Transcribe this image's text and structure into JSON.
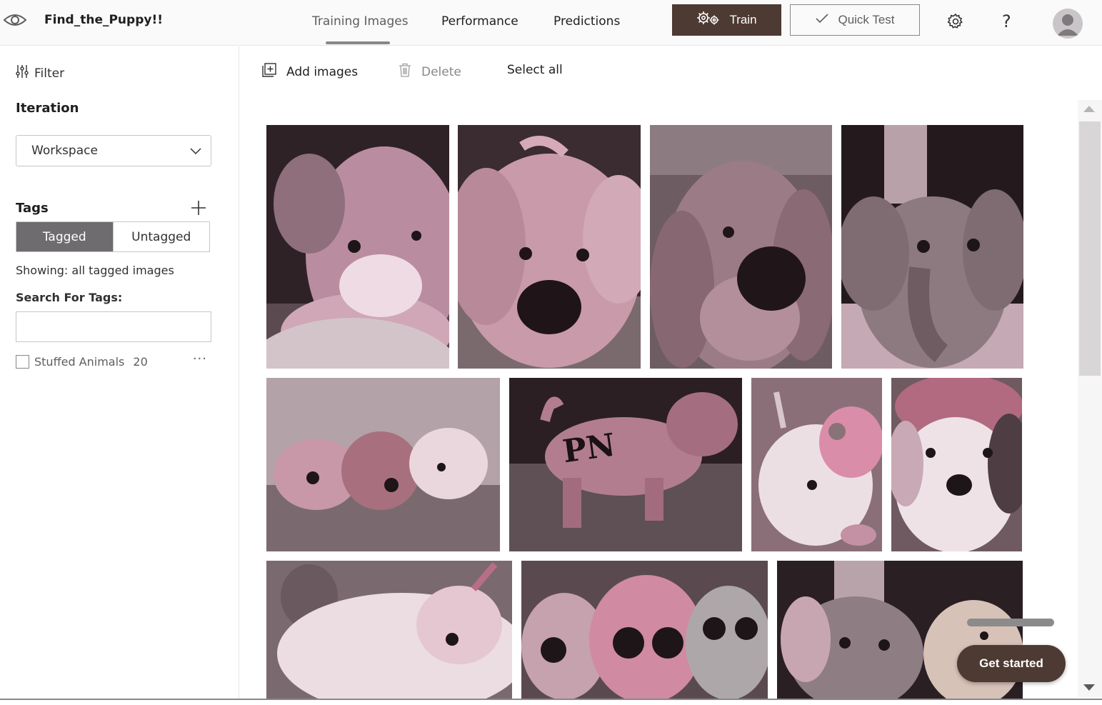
{
  "header": {
    "project_name": "Find_the_Puppy!!",
    "tabs": [
      {
        "label": "Training Images",
        "active": true
      },
      {
        "label": "Performance",
        "active": false
      },
      {
        "label": "Predictions",
        "active": false
      }
    ],
    "train_label": "Train",
    "quick_test_label": "Quick Test",
    "help_label": "?",
    "icons": {
      "logo": "eye-icon",
      "settings": "gear-icon",
      "train": "gears-icon",
      "quick_test": "checkmark-icon",
      "avatar": "user-avatar"
    },
    "accent_color": "#4d3a33"
  },
  "sidebar": {
    "filter_label": "Filter",
    "iteration_heading": "Iteration",
    "iteration_selected": "Workspace",
    "tags_heading": "Tags",
    "toggle": {
      "tagged": "Tagged",
      "untagged": "Untagged",
      "selected": "Tagged"
    },
    "showing_text": "Showing: all tagged images",
    "search_label": "Search For Tags:",
    "search_value": "",
    "tags": [
      {
        "name": "Stuffed Animals",
        "count": "20",
        "checked": false,
        "more": "···"
      }
    ]
  },
  "toolbar": {
    "add_images_label": "Add images",
    "delete_label": "Delete",
    "select_all_label": "Select all"
  },
  "gallery": {
    "image_count_visible": 11,
    "subjects": [
      "pink plush bunny",
      "pink plush puppy",
      "brown plush puppy with black nose",
      "plush elephant",
      "three plush toys on carpet",
      "pink PN plush dog",
      "white plush unicorn",
      "white and brown plush puppy",
      "white plush unicorn lying down",
      "big-eyed plush toys",
      "plush elephant and giraffe"
    ]
  },
  "get_started_label": "Get started"
}
